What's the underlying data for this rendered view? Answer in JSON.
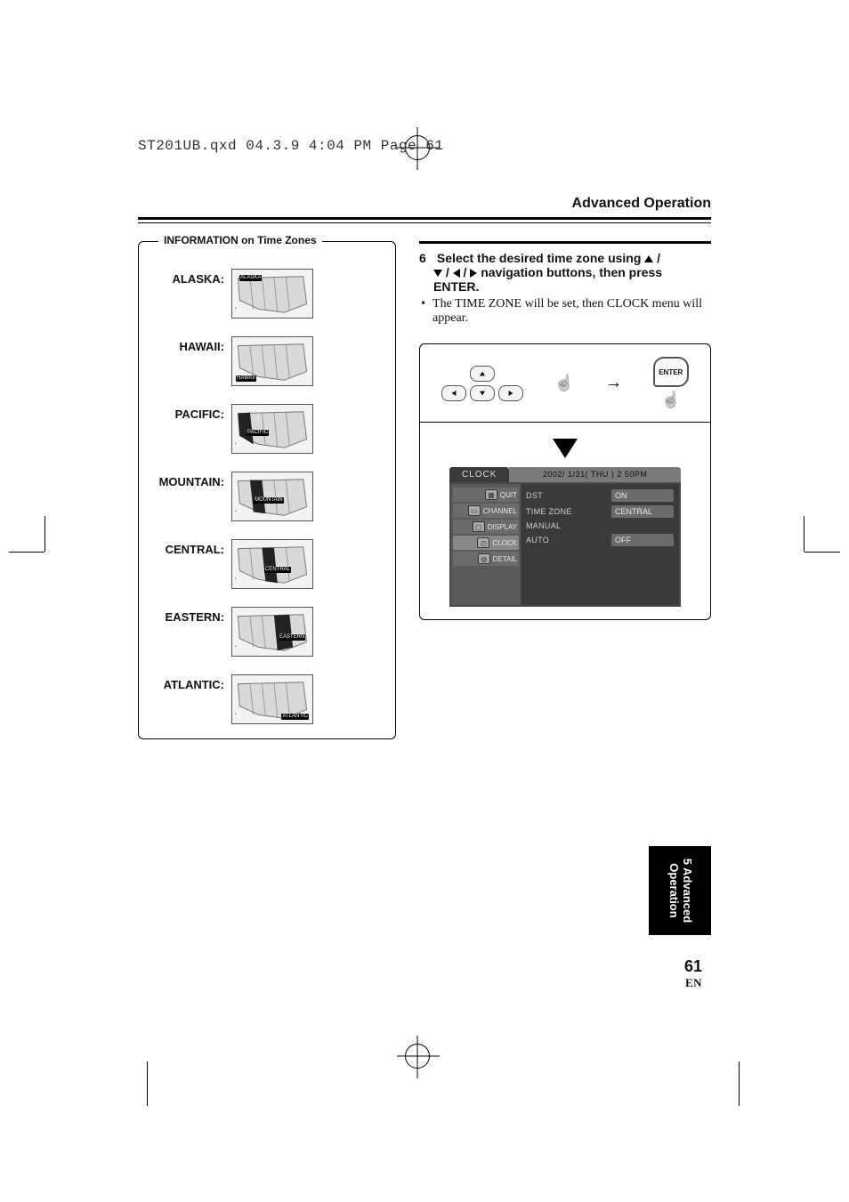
{
  "file_stamp": "ST201UB.qxd  04.3.9  4:04 PM  Page 61",
  "header": {
    "title": "Advanced Operation"
  },
  "info_box": {
    "title": "INFORMATION on Time Zones",
    "zones": [
      {
        "label": "ALASKA:",
        "tag": "ALASKA"
      },
      {
        "label": "HAWAII:",
        "tag": "HAWAII"
      },
      {
        "label": "PACIFIC:",
        "tag": "PACIFIC"
      },
      {
        "label": "MOUNTAIN:",
        "tag": "MOUNTAIN"
      },
      {
        "label": "CENTRAL:",
        "tag": "CENTRAL"
      },
      {
        "label": "EASTERN:",
        "tag": "EASTERN"
      },
      {
        "label": "ATLANTIC:",
        "tag": "ATLANTIC"
      }
    ]
  },
  "step": {
    "number": "6",
    "line1_a": "Select the desired time zone using ",
    "line1_b": " / ",
    "line2_a": " / ",
    "line2_b": " / ",
    "line2_c": " navigation buttons, then press ",
    "line3": "ENTER.",
    "bullet": "The TIME ZONE will be set, then CLOCK menu will appear."
  },
  "remote": {
    "enter": "ENTER"
  },
  "osd": {
    "tab": "CLOCK",
    "date": "2002/   1/31( THU )   2 50PM",
    "side": [
      {
        "label": "QUIT"
      },
      {
        "label": "CHANNEL"
      },
      {
        "label": "DISPLAY"
      },
      {
        "label": "CLOCK"
      },
      {
        "label": "DETAIL"
      }
    ],
    "rows": [
      {
        "k": "DST",
        "v": "ON"
      },
      {
        "k": "TIME ZONE",
        "v": "CENTRAL"
      },
      {
        "k": "MANUAL",
        "v": ""
      },
      {
        "k": "AUTO",
        "v": "OFF"
      }
    ]
  },
  "side_tab": {
    "line1": "5 Advanced",
    "line2": "Operation"
  },
  "page": {
    "number": "61",
    "lang": "EN"
  }
}
